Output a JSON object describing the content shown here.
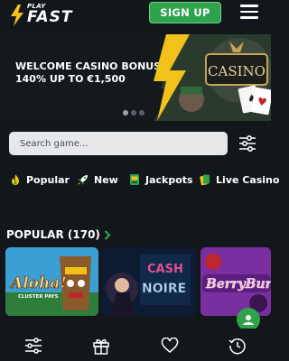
{
  "header": {
    "logo_small": "PLAY",
    "logo_big": "FAST",
    "signup_label": "SIGN UP"
  },
  "banner": {
    "title_line1": "WELCOME CASINO BONUS",
    "title_line2": "140% UP TO €1,500",
    "art_text": "CASINO",
    "active_slide": 1,
    "slide_count": 3
  },
  "search": {
    "placeholder": "Search game..."
  },
  "categories": [
    {
      "label": "Popular",
      "icon": "fire-icon"
    },
    {
      "label": "New",
      "icon": "rocket-icon"
    },
    {
      "label": "Jackpots",
      "icon": "slot-machine-icon"
    },
    {
      "label": "Live Casino",
      "icon": "cards-icon"
    }
  ],
  "popular": {
    "title": "POPULAR (170)"
  },
  "games": [
    {
      "title": "Aloha!",
      "subtitle": "CLUSTER PAYS"
    },
    {
      "title": "CASH NOIRE"
    },
    {
      "title": "BerryBur"
    }
  ],
  "bottom_nav": [
    {
      "icon": "filter-icon"
    },
    {
      "icon": "gift-icon"
    },
    {
      "icon": "heart-icon"
    },
    {
      "icon": "history-icon"
    }
  ],
  "colors": {
    "background": "#12171b",
    "accent_green": "#2fa24c",
    "brand_yellow": "#f2c21a"
  }
}
